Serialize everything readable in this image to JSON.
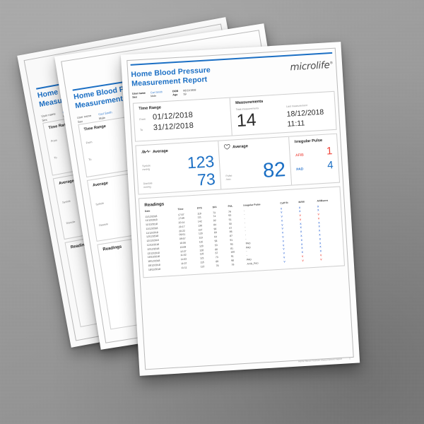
{
  "scene": {
    "background_color": "#9d9d9d",
    "sheet_count": 3
  },
  "report": {
    "title_line1": "Home Blood Pressure",
    "title_line2": "Measurement Report",
    "brand": "microlife",
    "brand_trademark": "®",
    "accent_color": "#1b6fc4",
    "alert_color": "#ef4136"
  },
  "user": {
    "name_label": "User name",
    "name_value": "Carl Smith",
    "sex_label": "Sex",
    "sex_value": "Male",
    "dob_label": "DOB",
    "dob_value": "06/11/1959",
    "age_label": "Age",
    "age_value": "59"
  },
  "time_range": {
    "heading": "Time Range",
    "from_label": "From",
    "from_value": "01/12/2018",
    "to_label": "To",
    "to_value": "31/12/2018"
  },
  "measurements": {
    "heading": "Measurements",
    "total_label": "Total measurements",
    "total_value": "14",
    "last_label": "Last measurement",
    "last_date": "18/12/2018",
    "last_time": "11:11"
  },
  "average_bp": {
    "heading": "Average",
    "icon": "ecg-icon",
    "systole_label": "Systole",
    "systole_unit": "mmHg",
    "systole_value": "123",
    "diastole_label": "Diastole",
    "diastole_unit": "mmHg",
    "diastole_value": "73"
  },
  "average_pulse": {
    "heading": "Average",
    "icon": "heart-icon",
    "pulse_label": "Pulse",
    "pulse_unit": "/min",
    "pulse_value": "82"
  },
  "irregular_pulse": {
    "heading": "Irregular Pulse",
    "afib_label": "AFIB",
    "afib_value": "1",
    "pad_label": "PAD",
    "pad_value": "4"
  },
  "readings": {
    "heading": "Readings",
    "columns": [
      "Date",
      "Time",
      "SYS",
      "DIA",
      "PUL",
      "Irregular Pulse",
      "Cuff fit",
      "MAM",
      "AFIBsens"
    ],
    "rows": [
      {
        "date": "11/12/2018",
        "time": "17:07",
        "sys": "119",
        "dia": "73",
        "pul": "79",
        "sys_high": false,
        "dia_high": false,
        "ip": "-",
        "cuff": "V",
        "mam": "X",
        "afib": "X",
        "cuff_alert": false,
        "mam_alert": false,
        "afib_alert": false
      },
      {
        "date": "11/12/2018",
        "time": "17:09",
        "sys": "111",
        "dia": "74",
        "pul": "93",
        "sys_high": false,
        "dia_high": false,
        "ip": "-",
        "cuff": "V",
        "mam": "X",
        "afib": "X",
        "cuff_alert": false,
        "mam_alert": false,
        "afib_alert": false
      },
      {
        "date": "11/12/2018",
        "time": "20:14",
        "sys": "142",
        "dia": "92",
        "pul": "51",
        "sys_high": true,
        "dia_high": true,
        "ip": "-",
        "cuff": "V",
        "mam": "V",
        "afib": "V",
        "cuff_alert": false,
        "mam_alert": true,
        "afib_alert": true
      },
      {
        "date": "11/12/2018",
        "time": "20:17",
        "sys": "136",
        "dia": "84",
        "pul": "50",
        "sys_high": true,
        "dia_high": false,
        "ip": "-",
        "cuff": "V",
        "mam": "V",
        "afib": "V",
        "cuff_alert": false,
        "mam_alert": true,
        "afib_alert": true
      },
      {
        "date": "11/12/2018",
        "time": "20:22",
        "sys": "157",
        "dia": "90",
        "pul": "67",
        "sys_high": true,
        "dia_high": true,
        "ip": "-",
        "cuff": "V",
        "mam": "X",
        "afib": "X",
        "cuff_alert": false,
        "mam_alert": false,
        "afib_alert": false
      },
      {
        "date": "12/12/2018",
        "time": "09:51",
        "sys": "120",
        "dia": "69",
        "pul": "86",
        "sys_high": false,
        "dia_high": false,
        "ip": "-",
        "cuff": "V",
        "mam": "X",
        "afib": "X",
        "cuff_alert": false,
        "mam_alert": false,
        "afib_alert": false
      },
      {
        "date": "12/12/2018",
        "time": "09:57",
        "sys": "110",
        "dia": "64",
        "pul": "87",
        "sys_high": false,
        "dia_high": false,
        "ip": "-",
        "cuff": "V",
        "mam": "X",
        "afib": "X",
        "cuff_alert": false,
        "mam_alert": false,
        "afib_alert": false
      },
      {
        "date": "12/12/2018",
        "time": "10:06",
        "sys": "115",
        "dia": "58",
        "pul": "91",
        "sys_high": false,
        "dia_high": false,
        "ip": "-",
        "cuff": "V",
        "mam": "X",
        "afib": "X",
        "cuff_alert": false,
        "mam_alert": false,
        "afib_alert": false
      },
      {
        "date": "12/12/2018",
        "time": "10:09",
        "sys": "120",
        "dia": "53",
        "pul": "93",
        "sys_high": false,
        "dia_high": false,
        "ip": "PAD",
        "cuff": "V",
        "mam": "X",
        "afib": "X",
        "cuff_alert": false,
        "mam_alert": false,
        "afib_alert": false
      },
      {
        "date": "12/12/2018",
        "time": "12:27",
        "sys": "128",
        "dia": "80",
        "pul": "81",
        "sys_high": false,
        "dia_high": false,
        "ip": "PAD",
        "cuff": "V",
        "mam": "X",
        "afib": "X",
        "cuff_alert": false,
        "mam_alert": false,
        "afib_alert": false
      },
      {
        "date": "18/12/2018",
        "time": "11:02",
        "sys": "119",
        "dia": "67",
        "pul": "100",
        "sys_high": false,
        "dia_high": false,
        "ip": "-",
        "cuff": "V",
        "mam": "X",
        "afib": "X",
        "cuff_alert": false,
        "mam_alert": false,
        "afib_alert": false
      },
      {
        "date": "18/12/2018",
        "time": "11:03",
        "sys": "121",
        "dia": "73",
        "pul": "91",
        "sys_high": false,
        "dia_high": false,
        "ip": "-",
        "cuff": "V",
        "mam": "X",
        "afib": "X",
        "cuff_alert": false,
        "mam_alert": false,
        "afib_alert": false
      },
      {
        "date": "18/12/2018",
        "time": "11:07",
        "sys": "115",
        "dia": "89",
        "pul": "98",
        "sys_high": false,
        "dia_high": false,
        "ip": "PAD",
        "cuff": "V",
        "mam": "V",
        "afib": "V",
        "cuff_alert": false,
        "mam_alert": true,
        "afib_alert": true
      },
      {
        "date": "18/12/2018",
        "time": "11:11",
        "sys": "113",
        "dia": "78",
        "pul": "79",
        "sys_high": false,
        "dia_high": false,
        "ip": "AFIB_PAD",
        "cuff": "V",
        "mam": "V",
        "afib": "V",
        "cuff_alert": false,
        "mam_alert": true,
        "afib_alert": true
      }
    ]
  },
  "footer": {
    "text": "Home Blood Pressure Measurement Report",
    "page_number": "1"
  }
}
